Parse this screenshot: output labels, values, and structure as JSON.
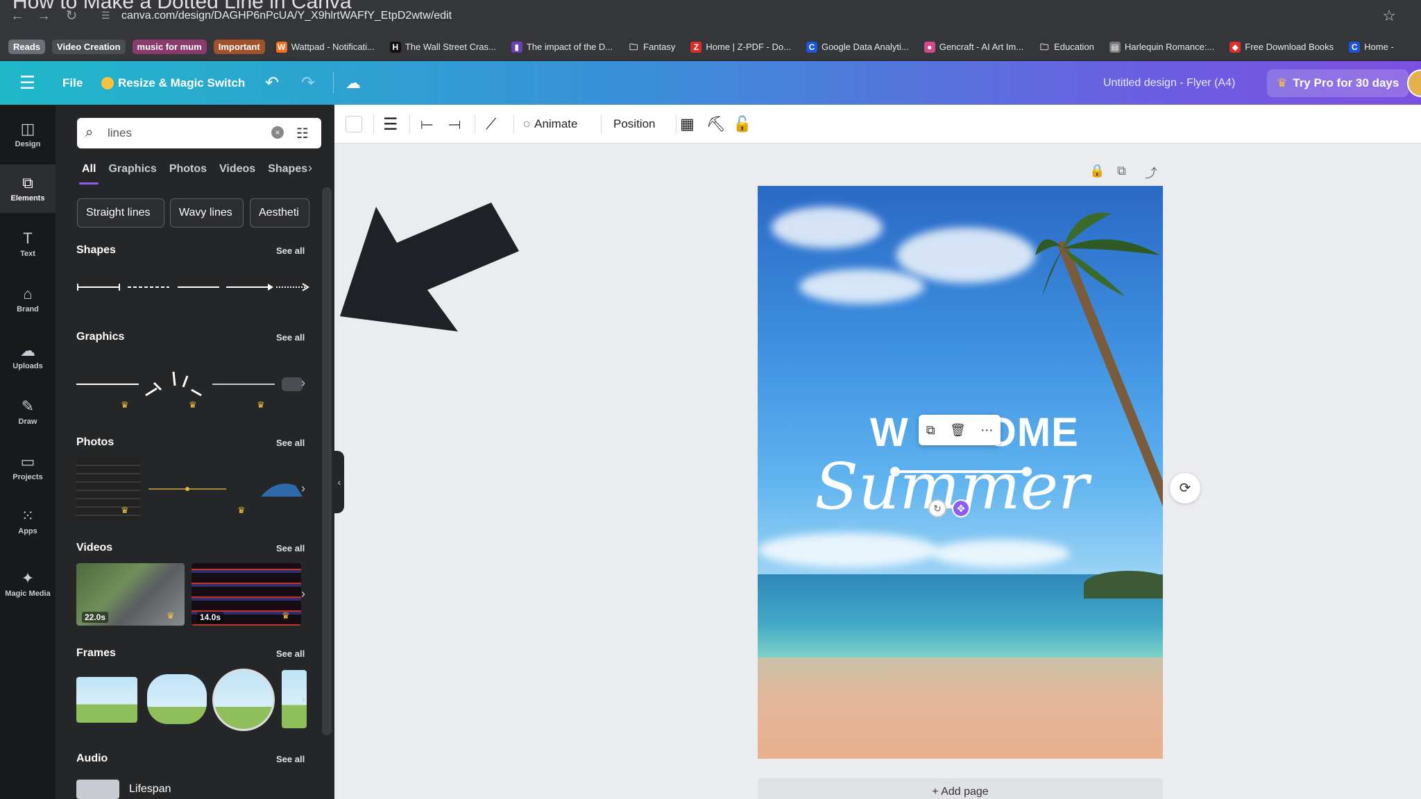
{
  "video_title": "How to Make a Dotted Line in Canva",
  "browser": {
    "url": "canva.com/design/DAGHP6nPcUA/Y_X9hlrtWAFfY_EtpD2wtw/edit",
    "bookmarks_tags": [
      {
        "label": "Reads",
        "color": "#6b6f76"
      },
      {
        "label": "Video Creation",
        "color": "#4a4d52"
      },
      {
        "label": "music for mum",
        "color": "#8a3b6e"
      },
      {
        "label": "Important",
        "color": "#a0522d"
      }
    ],
    "bookmarks": [
      {
        "label": "Wattpad - Notificati...",
        "icon_color": "#f36e21",
        "glyph": "W"
      },
      {
        "label": "The Wall Street Cras...",
        "icon_color": "#111111",
        "glyph": "H"
      },
      {
        "label": "The impact of the D...",
        "icon_color": "#6b3fb5",
        "glyph": "▮"
      },
      {
        "label": "Fantasy",
        "icon_color": "#35363a",
        "glyph": "🗀"
      },
      {
        "label": "Home | Z-PDF - Do...",
        "icon_color": "#d9302c",
        "glyph": "Z"
      },
      {
        "label": "Google Data Analyti...",
        "icon_color": "#1a57d6",
        "glyph": "C"
      },
      {
        "label": "Gencraft - AI Art Im...",
        "icon_color": "#d04a8a",
        "glyph": "●"
      },
      {
        "label": "Education",
        "icon_color": "#35363a",
        "glyph": "🗀"
      },
      {
        "label": "Harlequin Romance:...",
        "icon_color": "#777777",
        "glyph": "▤"
      },
      {
        "label": "Free Download Books",
        "icon_color": "#d9302c",
        "glyph": "◆"
      },
      {
        "label": "Home -",
        "icon_color": "#1a57d6",
        "glyph": "C"
      }
    ]
  },
  "header": {
    "file_label": "File",
    "resize_label": "Resize & Magic Switch",
    "design_title": "Untitled design - Flyer (A4)",
    "pro_label": "Try Pro for 30 days"
  },
  "rail": {
    "items": [
      {
        "label": "Design",
        "icon": "◫"
      },
      {
        "label": "Elements",
        "icon": "⧉"
      },
      {
        "label": "Text",
        "icon": "T"
      },
      {
        "label": "Brand",
        "icon": "⌂"
      },
      {
        "label": "Uploads",
        "icon": "☁"
      },
      {
        "label": "Draw",
        "icon": "✎"
      },
      {
        "label": "Projects",
        "icon": "▭"
      },
      {
        "label": "Apps",
        "icon": "⁙"
      },
      {
        "label": "Magic Media",
        "icon": "✦"
      }
    ]
  },
  "panel": {
    "search_value": "lines",
    "tabs": [
      "All",
      "Graphics",
      "Photos",
      "Videos",
      "Shapes"
    ],
    "chips": [
      "Straight lines",
      "Wavy lines",
      "Aestheti"
    ],
    "see_all": "See all",
    "sections": {
      "shapes": "Shapes",
      "graphics": "Graphics",
      "photos": "Photos",
      "videos": "Videos",
      "frames": "Frames",
      "audio": "Audio"
    },
    "video_durations": [
      "22.0s",
      "14.0s"
    ],
    "audio_track": "Lifespan"
  },
  "toolbar": {
    "animate_label": "Animate",
    "position_label": "Position"
  },
  "canvas": {
    "welcome_left": "W",
    "welcome_right": "OME",
    "summer": "Summer",
    "add_page": "+ Add page"
  },
  "colors": {
    "accent_purple": "#8b5cf6",
    "header_start": "#1fb8c9",
    "header_end": "#7d4fe0",
    "crown": "#f7c340"
  }
}
